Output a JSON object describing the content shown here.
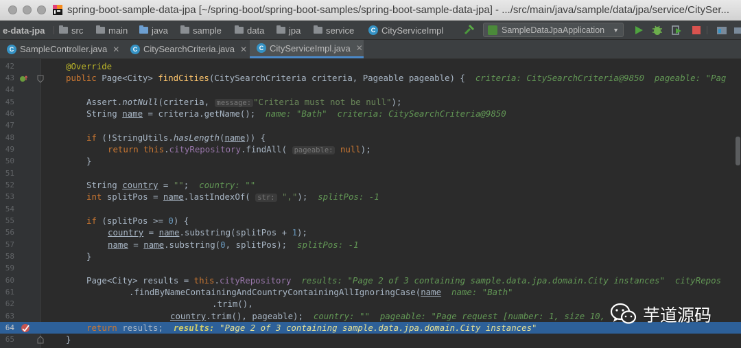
{
  "window": {
    "title": "spring-boot-sample-data-jpa [~/spring-boot/spring-boot-samples/spring-boot-sample-data-jpa] - .../src/main/java/sample/data/jpa/service/CitySer..."
  },
  "breadcrumb": {
    "items": [
      "e-data-jpa",
      "src",
      "main",
      "java",
      "sample",
      "data",
      "jpa",
      "service",
      "CityServiceImpl"
    ]
  },
  "run_config": {
    "label": "SampleDataJpaApplication"
  },
  "tabs": [
    {
      "label": "SampleController.java",
      "active": false
    },
    {
      "label": "CitySearchCriteria.java",
      "active": false
    },
    {
      "label": "CityServiceImpl.java",
      "active": true
    }
  ],
  "editor": {
    "line_numbers": [
      "42",
      "43",
      "44",
      "45",
      "46",
      "47",
      "48",
      "49",
      "50",
      "51",
      "52",
      "53",
      "54",
      "55",
      "56",
      "57",
      "58",
      "59",
      "60",
      "61",
      "62",
      "63",
      "64",
      "65"
    ],
    "execution_line": "64",
    "debug_values": {
      "l43": "criteria: CitySearchCriteria@9850  pageable: \"Pag",
      "l46": "name: \"Bath\"  criteria: CitySearchCriteria@9850",
      "l52": "country: \"\"",
      "l53": "splitPos: -1",
      "l57": "splitPos: -1",
      "l60": "results: \"Page 2 of 3 containing sample.data.jpa.domain.City instances\"  cityRepos",
      "l61": "name: \"Bath\"",
      "l63": "country: \"\"  pageable: \"Page request [number: 1, size 10,",
      "l64_key": "results:",
      "l64_val": "\"Page 2 of 3 containing sample.data.jpa.domain.City instances\""
    },
    "param_hints": {
      "message": "message:",
      "pageable": "pageable:",
      "str": "str:"
    }
  },
  "watermark": {
    "text": "芋道源码"
  }
}
